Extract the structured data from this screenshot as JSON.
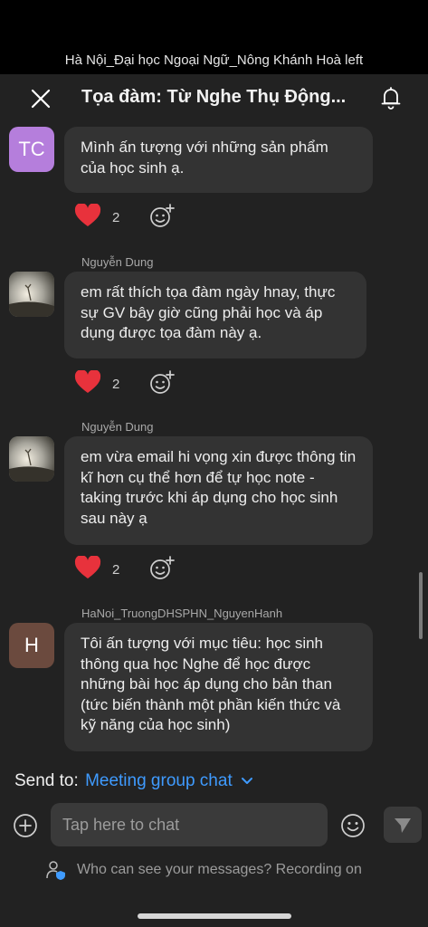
{
  "banner": {
    "text": "Hà Nội_Đại học Ngoại Ngữ_Nông Khánh Hoà left"
  },
  "header": {
    "title": "Tọa đàm: Từ Nghe Thụ Động..."
  },
  "messages": [
    {
      "sender": "",
      "avatar_initials": "TC",
      "avatar_color": "#b57edc",
      "text": "Mình ấn tượng với những sản phẩm của học sinh ạ.",
      "reaction": "heart",
      "reaction_count": "2"
    },
    {
      "sender": "Nguyễn Dung",
      "avatar_initials": "",
      "text": "em rất thích tọa đàm ngày hnay, thực sự GV bây giờ cũng phải học và áp dụng được tọa đàm này ạ.",
      "reaction": "heart",
      "reaction_count": "2"
    },
    {
      "sender": "Nguyễn Dung",
      "avatar_initials": "",
      "text": "em vừa email hi vọng xin được thông tin kĩ hơn cụ thể hơn để tự học note - taking trước khi áp dụng cho học sinh sau này ạ",
      "reaction": "heart",
      "reaction_count": "2"
    },
    {
      "sender": "HaNoi_TruongDHSPHN_NguyenHanh",
      "avatar_initials": "H",
      "avatar_color": "#6b4a3e",
      "text": "Tôi ấn tượng với mục tiêu: học sinh thông qua học Nghe để học được những bài học áp dụng cho bản than (tức biến thành một phần kiến thức và kỹ năng của học sinh)"
    }
  ],
  "composer": {
    "send_to_label": "Send to:",
    "send_to_target": "Meeting group chat",
    "placeholder": "Tap here to chat",
    "privacy_text": "Who can see your messages? Recording on"
  },
  "colors": {
    "accent": "#3f9bff",
    "heart": "#e8323c",
    "panel": "#222222",
    "bubble": "#333333"
  }
}
